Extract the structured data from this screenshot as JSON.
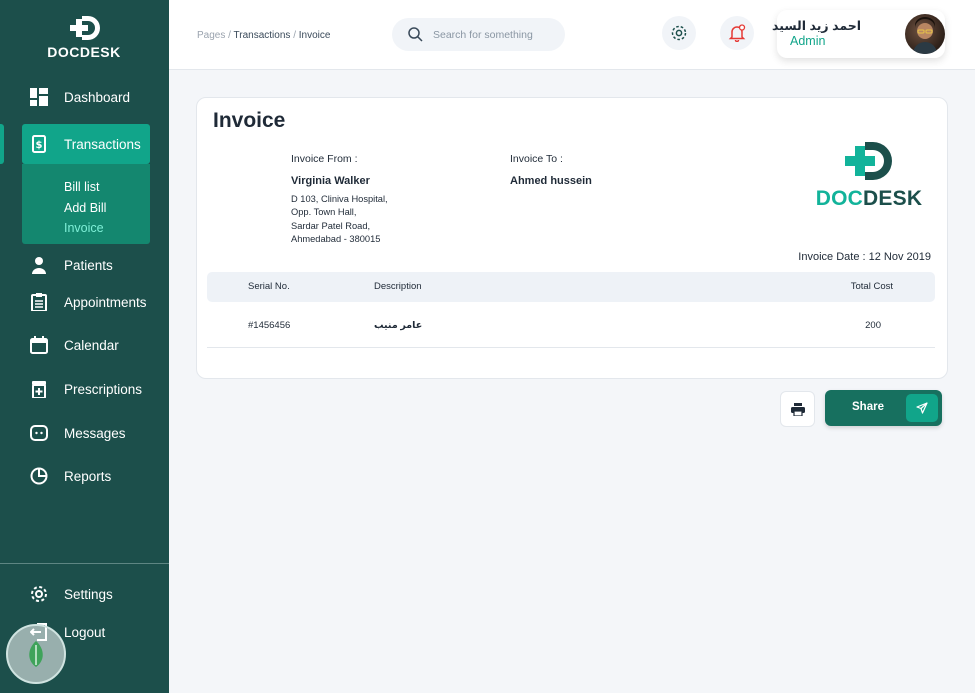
{
  "brand": {
    "logo_text": "DOCDESK",
    "logo_doc": "DOC",
    "logo_desk": "DESK"
  },
  "colors": {
    "sidebar": "#1c4f4b",
    "accent": "#11a58a",
    "share": "#17705f"
  },
  "sidebar": {
    "items": [
      {
        "label": "Dashboard",
        "icon": "dashboard-icon"
      },
      {
        "label": "Transactions",
        "icon": "receipt-icon",
        "active": true
      },
      {
        "label": "Patients",
        "icon": "person-icon"
      },
      {
        "label": "Appointments",
        "icon": "clipboard-icon"
      },
      {
        "label": "Calendar",
        "icon": "calendar-icon"
      },
      {
        "label": "Prescriptions",
        "icon": "prescription-icon"
      },
      {
        "label": "Messages",
        "icon": "message-icon"
      },
      {
        "label": "Reports",
        "icon": "pie-chart-icon"
      }
    ],
    "submenu": [
      "Bill list",
      "Add Bill",
      "Invoice"
    ],
    "bottom": [
      {
        "label": "Settings",
        "icon": "gear-icon"
      },
      {
        "label": "Logout",
        "icon": "logout-icon"
      }
    ]
  },
  "header": {
    "breadcrumb": {
      "root": "Pages",
      "middle": "Transactions",
      "current": "Invoice",
      "sep": "/"
    },
    "search_placeholder": "Search for something",
    "user": {
      "name": "احمد زيد السيد",
      "role": "Admin"
    }
  },
  "invoice": {
    "title": "Invoice",
    "from_label": "Invoice From :",
    "from_name": "Virginia Walker",
    "from_address": [
      "D 103, Cliniva Hospital,",
      "Opp. Town Hall,",
      "Sardar Patel Road,",
      "Ahmedabad - 380015"
    ],
    "to_label": "Invoice To :",
    "to_name": "Ahmed hussein",
    "date": "Invoice Date : 12 Nov 2019",
    "table": {
      "headers": [
        "Serial No.",
        "Description",
        "Total Cost"
      ],
      "rows": [
        [
          "#1456456",
          "عامر منيب",
          "200"
        ]
      ]
    }
  },
  "actions": {
    "share_label": "Share"
  }
}
